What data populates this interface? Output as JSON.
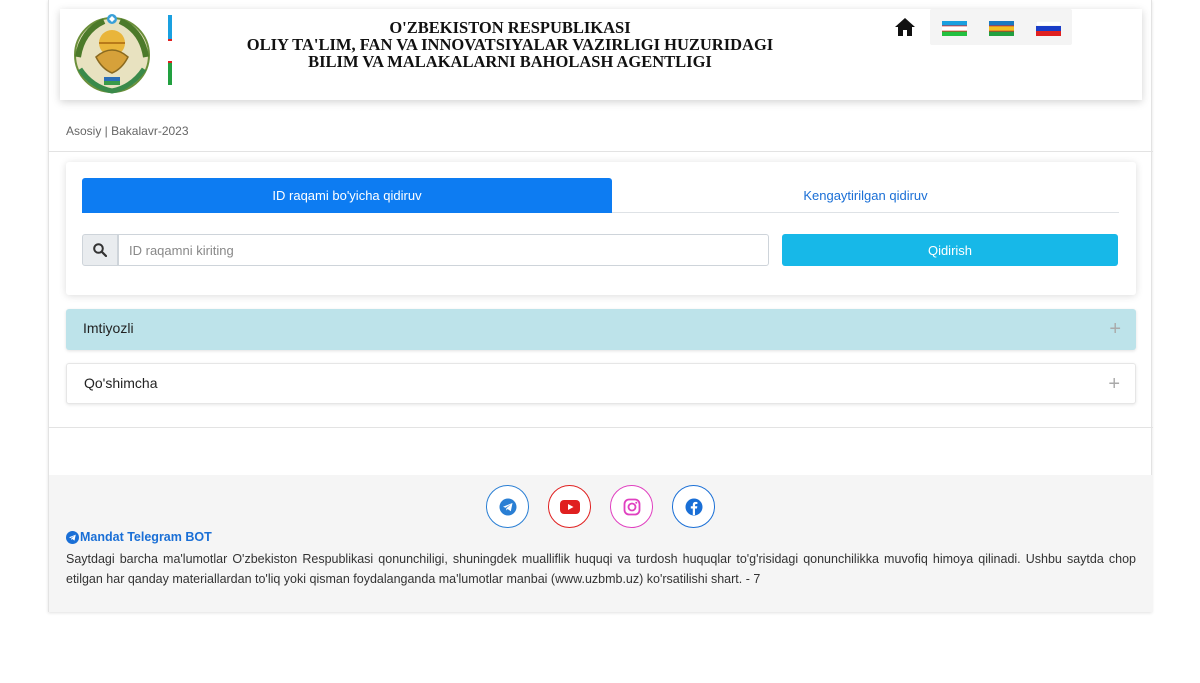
{
  "header": {
    "title_lines": [
      "O'ZBEKISTON RESPUBLIKASI",
      "OLIY TA'LIM, FAN VA INNOVATSIYALAR VAZIRLIGI HUZURIDAGI",
      "BILIM VA MALAKALARNI BAHOLASH AGENTLIGI"
    ],
    "home_icon": "home-icon",
    "flags": [
      "uzbekistan-flag",
      "karakalpakstan-flag",
      "russia-flag"
    ]
  },
  "breadcrumb": "Asosiy | Bakalavr-2023",
  "search": {
    "tab_active": "ID raqami bo'yicha qidiruv",
    "tab_other": "Kengaytirilgan qidiruv",
    "placeholder": "ID raqamni kiriting",
    "value": "",
    "button": "Qidirish"
  },
  "accordion": [
    {
      "label": "Imtiyozli",
      "icon": "+"
    },
    {
      "label": "Qo'shimcha",
      "icon": "+"
    }
  ],
  "footer": {
    "social": [
      "telegram-icon",
      "youtube-icon",
      "instagram-icon",
      "facebook-icon"
    ],
    "telegram_bot": "Mandat Telegram BOT",
    "text": "Saytdagi barcha ma'lumotlar O'zbekiston Respublikasi qonunchiligi, shuningdek mualliflik huquqi va turdosh huquqlar to'g'risidagi qonunchilikka muvofiq himoya qilinadi. Ushbu saytda chop etilgan har qanday materiallardan to'liq yoki qisman foydalanganda ma'lumotlar manbai (www.uzbmb.uz) ko'rsatilishi shart. - 7"
  },
  "colors": {
    "primary": "#0d7cf2",
    "info": "#17b8e8",
    "accordion_active": "#bde3ea",
    "telegram": "#2a7fd4",
    "youtube": "#e02020",
    "instagram": "#e040c0",
    "facebook": "#1a6fd6"
  }
}
